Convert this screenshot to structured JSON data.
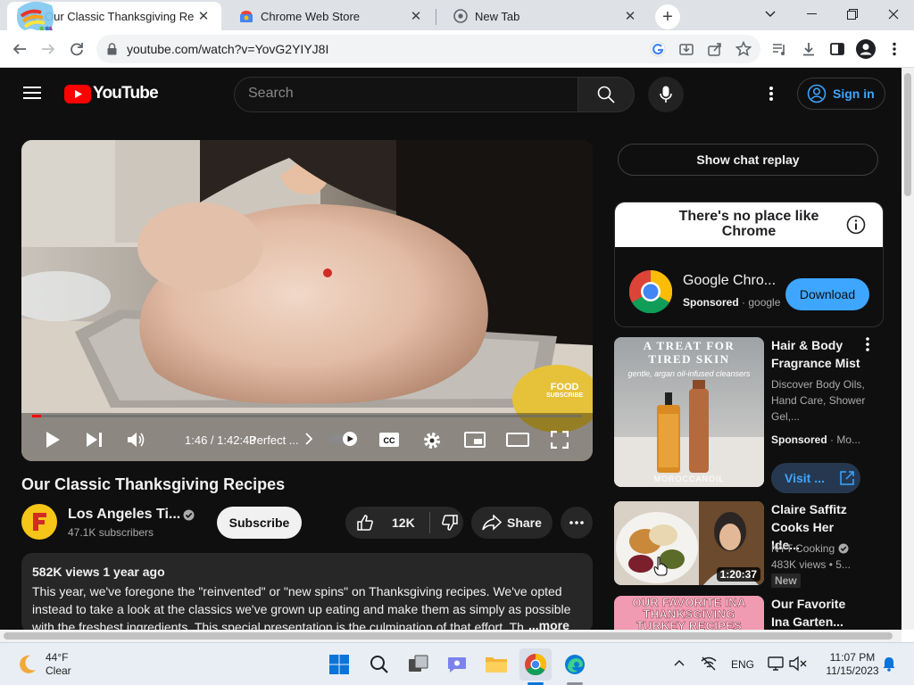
{
  "browser": {
    "tabs": [
      {
        "title": "Our Classic Thanksgiving Recipe",
        "active": true
      },
      {
        "title": "Chrome Web Store",
        "active": false
      },
      {
        "title": "New Tab",
        "active": false
      }
    ],
    "new_tab_symbol": "+",
    "url": "youtube.com/watch?v=YovG2YIYJ8I"
  },
  "youtube": {
    "logo_text": "YouTube",
    "search_placeholder": "Search",
    "sign_in": "Sign in"
  },
  "player": {
    "time": "1:46 / 1:42:43",
    "chapter": "Perfect ...",
    "watermark_line1": "FOOD",
    "watermark_line2": "SUBSCRIBE",
    "progress": 0.017
  },
  "video": {
    "title": "Our Classic Thanksgiving Recipes",
    "channel": "Los Angeles Ti...",
    "subscribers": "47.1K subscribers",
    "subscribe_label": "Subscribe",
    "likes": "12K",
    "share_label": "Share",
    "views_date": "582K views  1 year ago",
    "description": "This year, we've foregone the \"reinvented\" or \"new spins\" on Thanksgiving recipes. We've opted instead to take a look at the classics we've grown up eating and make them as simply as possible with the freshest ingredients. This special presentation is the culmination of that effort. The",
    "more_label": "...more"
  },
  "sidebar": {
    "chat_replay": "Show chat replay",
    "ad": {
      "headline": "There's no place like Chrome",
      "name": "Google Chro...",
      "sponsored": "Sponsored",
      "domain": "google",
      "download_label": "Download"
    },
    "items": [
      {
        "title": "Hair & Body Fragrance Mist",
        "meta": "Discover Body Oils, Hand Care, Shower Gel,...",
        "sponsored": "Sponsored",
        "sponsor_name": "Mo...",
        "thumb_line1": "A TREAT FOR",
        "thumb_line2": "TIRED SKIN",
        "thumb_sub": "gentle, argan oil-infused cleansers",
        "thumb_brand": "MOROCCANOIL",
        "visit_label": "Visit ..."
      },
      {
        "title": "Claire Saffitz Cooks Her Ide...",
        "channel": "NYT Cooking",
        "meta": "483K views  • 5...",
        "badge": "New",
        "duration": "1:20:37"
      },
      {
        "title": "Our Favorite Ina Garten...",
        "thumb_line1": "OUR FAVORITE INA",
        "thumb_line2": "THANKSGIVING",
        "thumb_line3": "TURKEY RECIPES"
      }
    ]
  },
  "taskbar": {
    "temperature": "44°F",
    "weather": "Clear",
    "language": "ENG",
    "time": "11:07 PM",
    "date": "11/15/2023"
  }
}
